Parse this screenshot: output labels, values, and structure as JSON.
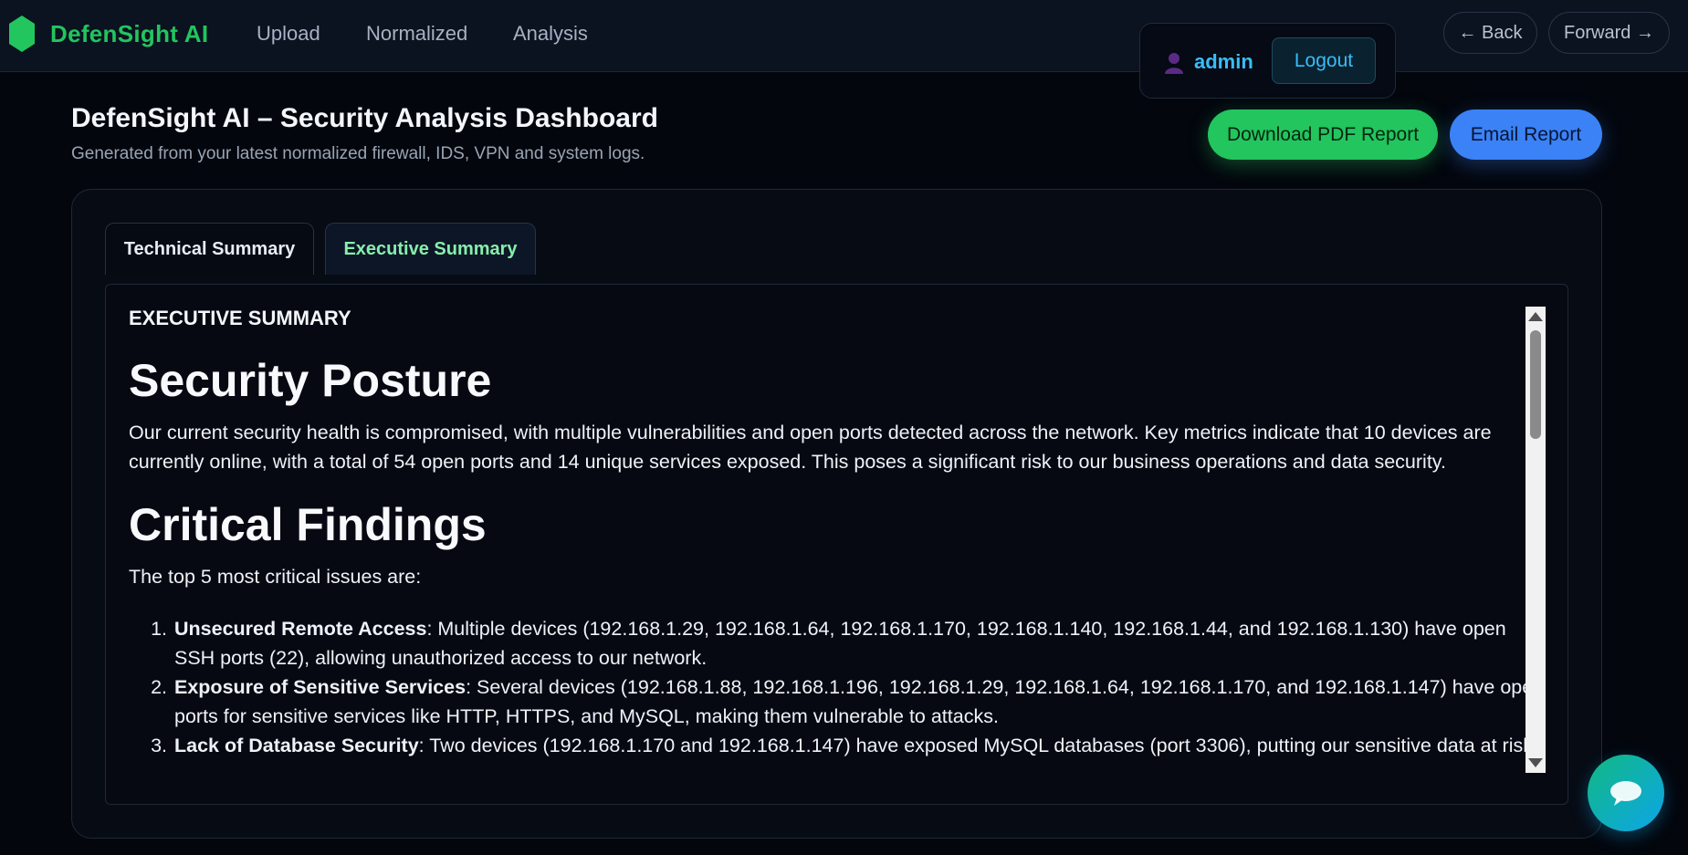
{
  "nav": {
    "brand": "DefenSight AI",
    "links": [
      "Upload",
      "Normalized",
      "Analysis"
    ],
    "user": "admin",
    "logout": "Logout",
    "back": "← Back",
    "forward": "Forward →"
  },
  "header": {
    "title": "DefenSight AI – Security Analysis Dashboard",
    "subtitle": "Generated from your latest normalized firewall, IDS, VPN and system logs.",
    "download_pdf": "Download PDF Report",
    "email_report": "Email Report"
  },
  "tabs": {
    "technical": "Technical Summary",
    "executive": "Executive Summary",
    "active": "executive"
  },
  "report": {
    "section_label": "EXECUTIVE SUMMARY",
    "posture_heading": "Security Posture",
    "posture_text": "Our current security health is compromised, with multiple vulnerabilities and open ports detected across the network. Key metrics indicate that 10 devices are currently online, with a total of 54 open ports and 14 unique services exposed. This poses a significant risk to our business operations and data security.",
    "findings_heading": "Critical Findings",
    "findings_intro": "The top 5 most critical issues are:",
    "findings": [
      {
        "title": "Unsecured Remote Access",
        "text": ": Multiple devices (192.168.1.29, 192.168.1.64, 192.168.1.170, 192.168.1.140, 192.168.1.44, and 192.168.1.130) have open SSH ports (22), allowing unauthorized access to our network."
      },
      {
        "title": "Exposure of Sensitive Services",
        "text": ": Several devices (192.168.1.88, 192.168.1.196, 192.168.1.29, 192.168.1.64, 192.168.1.170, and 192.168.1.147) have open ports for sensitive services like HTTP, HTTPS, and MySQL, making them vulnerable to attacks."
      },
      {
        "title": "Lack of Database Security",
        "text": ": Two devices (192.168.1.170 and 192.168.1.147) have exposed MySQL databases (port 3306), putting our sensitive data at risk."
      }
    ]
  },
  "colors": {
    "brand_green": "#22c55e",
    "accent_blue": "#3b82f6",
    "user_cyan": "#38bdf8",
    "background": "#03060d"
  },
  "icons": {
    "brand": "hexagon-logo-icon",
    "user": "user-icon",
    "chat": "chat-bubble-icon"
  }
}
